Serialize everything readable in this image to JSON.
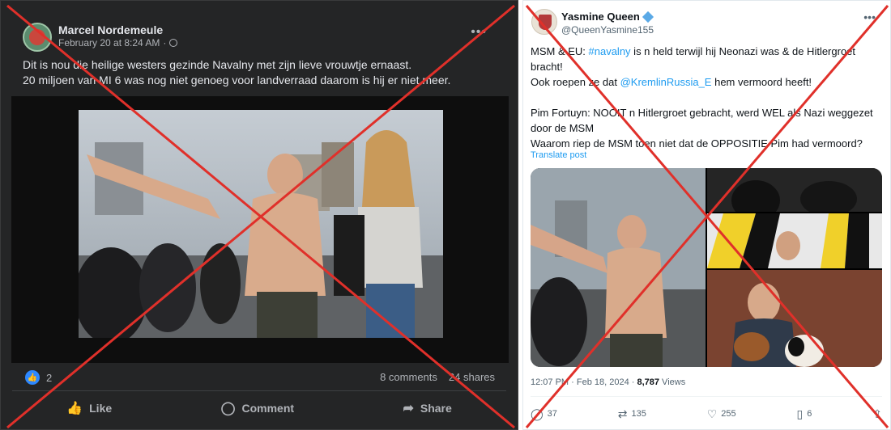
{
  "facebook_post": {
    "author": "Marcel Nordemeule",
    "timestamp": "February 20 at 8:24 AM",
    "visibility_icon": "globe-icon",
    "text_lines": [
      "Dit is nou die heilige westers gezinde Navalny met zijn lieve vrouwtje ernaast.",
      "20 miljoen van MI 6 was nog niet genoeg voor landverraad daarom is hij er niet meer."
    ],
    "reaction_count": "2",
    "comments": "8 comments",
    "shares": "24 shares",
    "actions": {
      "like": "Like",
      "comment": "Comment",
      "share": "Share"
    }
  },
  "twitter_post": {
    "display_name": "Yasmine Queen",
    "handle": "@QueenYasmine155",
    "text": {
      "l1_a": "MSM & EU: ",
      "l1_tag": "#navalny",
      "l1_b": " is n held terwijl hij Neonazi was & de Hitlergroet bracht!",
      "l2_a": "Ook roepen ze dat ",
      "l2_mention": "@KremlinRussia_E",
      "l2_b": " hem vermoord heeft!",
      "l3": "Pim Fortuyn: NOOIT n Hitlergroet gebracht, werd WEL als Nazi weggezet door de MSM",
      "l4": "Waarom riep de MSM toen niet dat de OPPOSITIE Pim had vermoord?"
    },
    "translate": "Translate post",
    "time": "12:07 PM · Feb 18, 2024 · ",
    "views_count": "8,787",
    "views_label": " Views",
    "stats": {
      "replies": "37",
      "reposts": "135",
      "likes": "255",
      "bookmarks": "6"
    }
  },
  "colors": {
    "fb_bg": "#242526",
    "tw_link": "#1d9bf0",
    "cross_red": "#e0302a"
  }
}
